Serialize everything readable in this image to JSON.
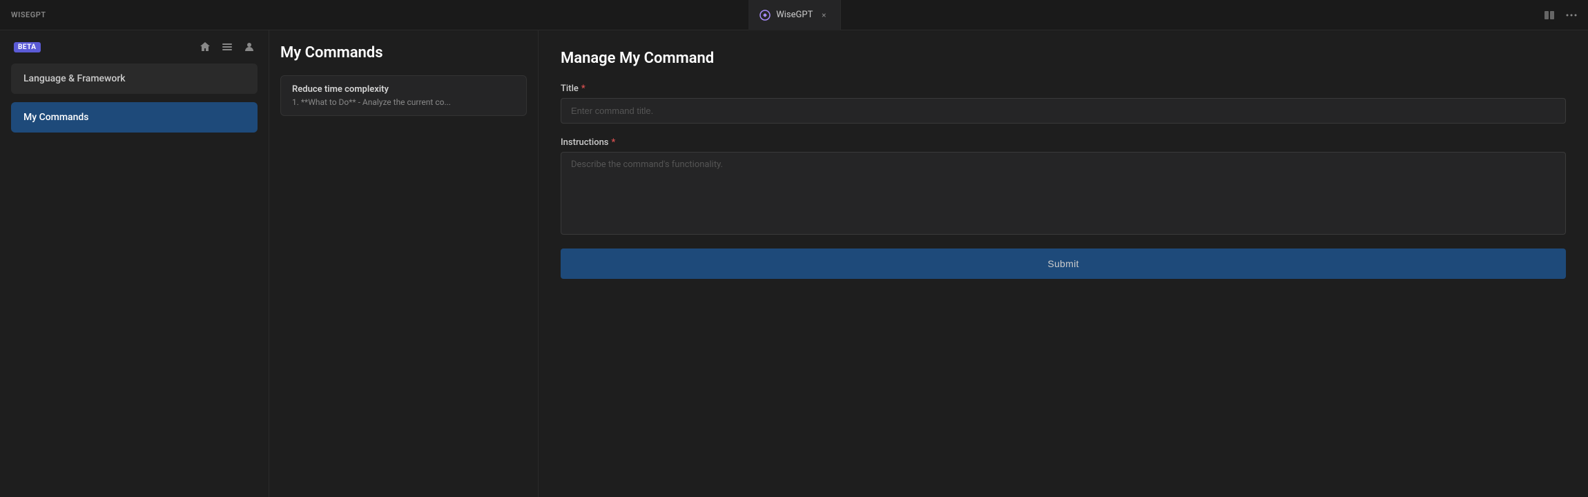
{
  "titlebar": {
    "app_name": "WISEGPT",
    "tab_name": "WiseGPT",
    "close_label": "×",
    "icons": {
      "split_view": "⊟",
      "more": "···"
    }
  },
  "sidebar": {
    "beta_label": "BETA",
    "icons": {
      "home": "home",
      "list": "list",
      "user": "user"
    },
    "items": [
      {
        "id": "language-framework",
        "label": "Language & Framework",
        "active": false
      },
      {
        "id": "my-commands",
        "label": "My Commands",
        "active": true
      }
    ]
  },
  "commands_panel": {
    "title": "My Commands",
    "items": [
      {
        "title": "Reduce time complexity",
        "preview": "1. **What to Do** - Analyze the current co..."
      }
    ]
  },
  "manage_panel": {
    "title": "Manage My Command",
    "title_field": {
      "label": "Title",
      "placeholder": "Enter command title."
    },
    "instructions_field": {
      "label": "Instructions",
      "placeholder": "Describe the command's functionality."
    },
    "submit_label": "Submit"
  }
}
